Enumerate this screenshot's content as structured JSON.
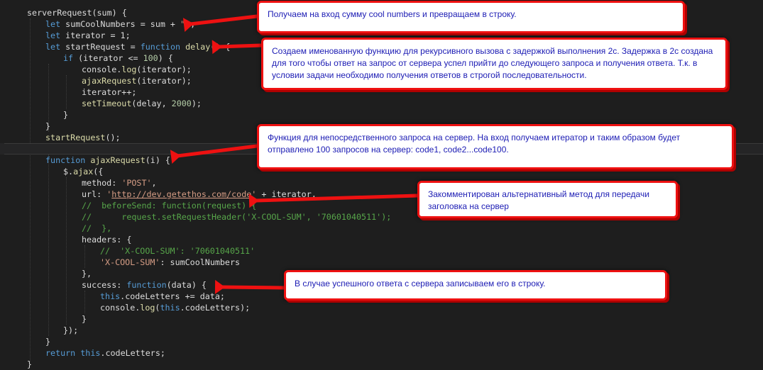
{
  "code_lines": [
    {
      "tokens": [
        {
          "t": "plain",
          "v": "serverRequest(sum) {"
        }
      ]
    },
    {
      "tokens": [
        {
          "t": "kw",
          "v": "let "
        },
        {
          "t": "plain",
          "v": "sumCoolNumbers = sum + "
        },
        {
          "t": "str",
          "v": "\"\""
        },
        {
          "t": "plain",
          "v": ";"
        }
      ]
    },
    {
      "tokens": [
        {
          "t": "kw",
          "v": "let "
        },
        {
          "t": "plain",
          "v": "iterator = 1;"
        }
      ]
    },
    {
      "tokens": [
        {
          "t": "kw",
          "v": "let "
        },
        {
          "t": "plain",
          "v": "startRequest = "
        },
        {
          "t": "kw",
          "v": "function "
        },
        {
          "t": "fn",
          "v": "delay"
        },
        {
          "t": "plain",
          "v": "() {"
        }
      ]
    },
    {
      "tokens": [
        {
          "t": "kw",
          "v": "if "
        },
        {
          "t": "plain",
          "v": "(iterator <= "
        },
        {
          "t": "num",
          "v": "100"
        },
        {
          "t": "plain",
          "v": ") {"
        }
      ]
    },
    {
      "tokens": [
        {
          "t": "plain",
          "v": "console."
        },
        {
          "t": "fn",
          "v": "log"
        },
        {
          "t": "plain",
          "v": "(iterator);"
        }
      ]
    },
    {
      "tokens": [
        {
          "t": "fn",
          "v": "ajaxRequest"
        },
        {
          "t": "plain",
          "v": "(iterator);"
        }
      ]
    },
    {
      "tokens": [
        {
          "t": "plain",
          "v": "iterator++;"
        }
      ]
    },
    {
      "tokens": [
        {
          "t": "fn",
          "v": "setTimeout"
        },
        {
          "t": "plain",
          "v": "(delay, "
        },
        {
          "t": "num",
          "v": "2000"
        },
        {
          "t": "plain",
          "v": ");"
        }
      ]
    },
    {
      "tokens": [
        {
          "t": "plain",
          "v": "}"
        }
      ]
    },
    {
      "tokens": [
        {
          "t": "plain",
          "v": "}"
        }
      ]
    },
    {
      "tokens": [
        {
          "t": "fn",
          "v": "startRequest"
        },
        {
          "t": "plain",
          "v": "();"
        }
      ]
    },
    {
      "tokens": []
    },
    {
      "tokens": [
        {
          "t": "kw",
          "v": "function "
        },
        {
          "t": "fn",
          "v": "ajaxRequest"
        },
        {
          "t": "plain",
          "v": "(i) {"
        }
      ]
    },
    {
      "tokens": [
        {
          "t": "plain",
          "v": "$."
        },
        {
          "t": "fn",
          "v": "ajax"
        },
        {
          "t": "plain",
          "v": "({"
        }
      ]
    },
    {
      "tokens": [
        {
          "t": "prop",
          "v": "method"
        },
        {
          "t": "plain",
          "v": ": "
        },
        {
          "t": "str",
          "v": "'POST'"
        },
        {
          "t": "plain",
          "v": ","
        }
      ]
    },
    {
      "tokens": [
        {
          "t": "prop",
          "v": "url"
        },
        {
          "t": "plain",
          "v": ": "
        },
        {
          "t": "str",
          "v": "'"
        },
        {
          "t": "url",
          "v": "http://dev.getethos.com/code"
        },
        {
          "t": "str",
          "v": "'"
        },
        {
          "t": "plain",
          "v": " + iterator,"
        }
      ]
    },
    {
      "tokens": [
        {
          "t": "cm",
          "v": "//  beforeSend: function(request) {"
        }
      ]
    },
    {
      "tokens": [
        {
          "t": "cm",
          "v": "//      request.setRequestHeader('X-COOL-SUM', '70601040511');"
        }
      ]
    },
    {
      "tokens": [
        {
          "t": "cm",
          "v": "//  },"
        }
      ]
    },
    {
      "tokens": [
        {
          "t": "prop",
          "v": "headers"
        },
        {
          "t": "plain",
          "v": ": {"
        }
      ]
    },
    {
      "tokens": [
        {
          "t": "cm",
          "v": "//  'X-COOL-SUM': '70601040511'"
        }
      ]
    },
    {
      "tokens": [
        {
          "t": "str",
          "v": "'X-COOL-SUM'"
        },
        {
          "t": "plain",
          "v": ": sumCoolNumbers"
        }
      ]
    },
    {
      "tokens": [
        {
          "t": "plain",
          "v": "},"
        }
      ]
    },
    {
      "tokens": [
        {
          "t": "prop",
          "v": "success"
        },
        {
          "t": "plain",
          "v": ": "
        },
        {
          "t": "kw",
          "v": "function"
        },
        {
          "t": "plain",
          "v": "(data) {"
        }
      ]
    },
    {
      "tokens": [
        {
          "t": "kw",
          "v": "this"
        },
        {
          "t": "plain",
          "v": ".codeLetters += data;"
        }
      ]
    },
    {
      "tokens": [
        {
          "t": "plain",
          "v": "console."
        },
        {
          "t": "fn",
          "v": "log"
        },
        {
          "t": "plain",
          "v": "("
        },
        {
          "t": "kw",
          "v": "this"
        },
        {
          "t": "plain",
          "v": ".codeLetters);"
        }
      ]
    },
    {
      "tokens": [
        {
          "t": "plain",
          "v": "}"
        }
      ]
    },
    {
      "tokens": [
        {
          "t": "plain",
          "v": "});"
        }
      ]
    },
    {
      "tokens": [
        {
          "t": "plain",
          "v": "}"
        }
      ]
    },
    {
      "tokens": [
        {
          "t": "kw",
          "v": "return "
        },
        {
          "t": "kw",
          "v": "this"
        },
        {
          "t": "plain",
          "v": ".codeLetters;"
        }
      ]
    },
    {
      "tokens": [
        {
          "t": "plain",
          "v": "}"
        }
      ]
    }
  ],
  "callouts": {
    "sum_to_string": "Получаем на вход сумму cool numbers и превращаем в строку.",
    "named_function": "Создаем именованную функцию для рекурсивного вызова с задержкой выполнения 2с. Задержка в 2с создана для того чтобы ответ на запрос от сервера успел прийти до следующего запроса и получения ответа. Т.к. в условии задачи необходимо получения ответов в строгой последовательности.",
    "ajax_function": "Функция для непосредственного запроса на сервер. На вход получаем итератор и таким образом будет отправлено 100 запросов на сервер: code1, code2...code100.",
    "commented_method": "Закомментирован альтернативный метод для передачи заголовка на сервер",
    "success_handler": "В случае успешного ответа с сервера записываем его в строку."
  },
  "colors": {
    "background": "#1e1e1e",
    "keyword": "#569cd6",
    "function": "#dcdcaa",
    "string": "#d69d85",
    "number": "#b5cea8",
    "comment": "#57a64a",
    "callout_border": "#ee1111",
    "callout_text": "#1c1cb4"
  }
}
